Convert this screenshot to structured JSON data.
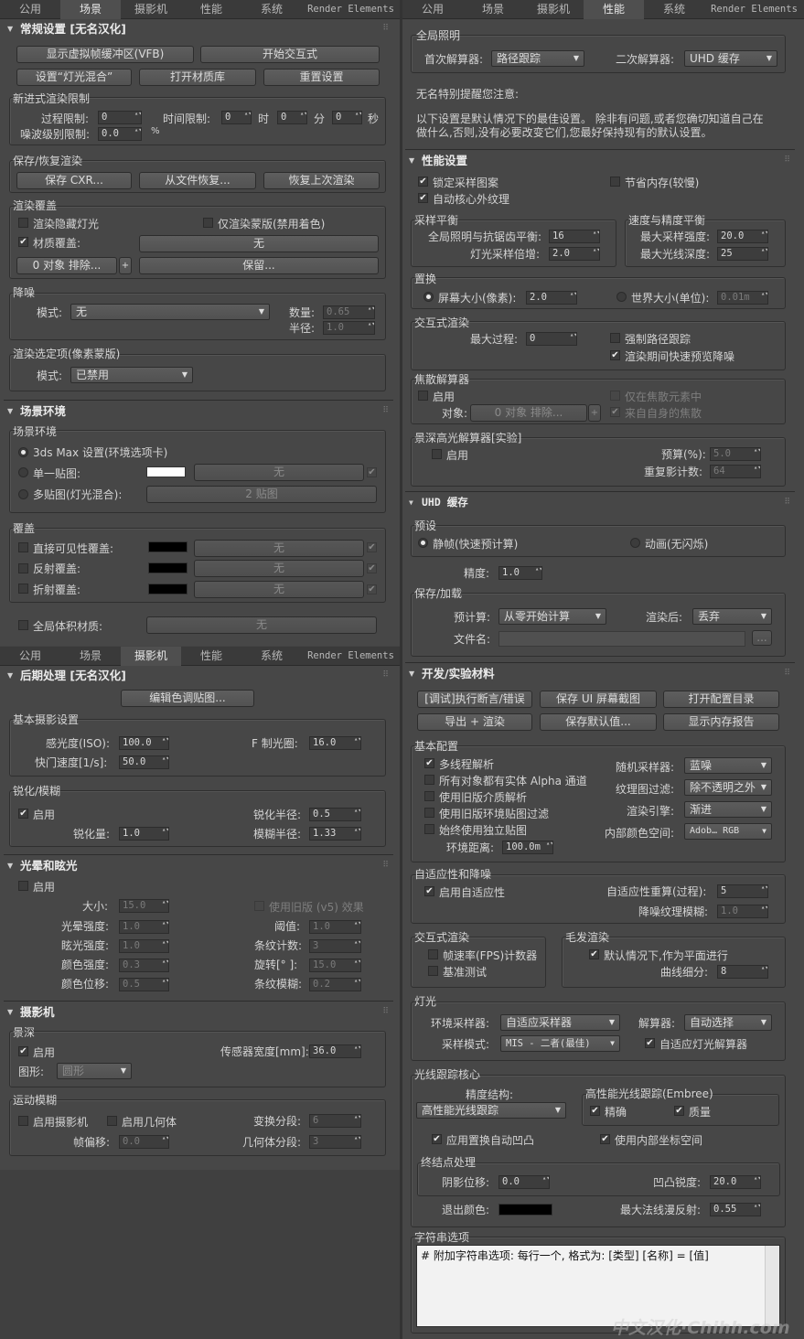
{
  "tabs": {
    "public": "公用",
    "scene": "场景",
    "camera": "摄影机",
    "perf": "性能",
    "system": "系统",
    "render_elements": "Render Elements"
  },
  "general": {
    "title": "常规设置 [无名汉化]",
    "btn_vfb": "显示虚拟帧缓冲区(VFB)",
    "btn_ipr": "开始交互式",
    "btn_lightmix": "设置“灯光混合”",
    "btn_matlib": "打开材质库",
    "btn_reset": "重置设置",
    "limits_title": "新进式渲染限制",
    "passes_label": "过程限制:",
    "passes_val": "0",
    "time_label": "时间限制:",
    "time_h": "0",
    "unit_h": "时",
    "time_m": "0",
    "unit_m": "分",
    "time_s": "0",
    "unit_s": "秒",
    "noise_label": "噪波级别限制:",
    "noise_val": "0.0",
    "noise_unit": "%",
    "save_title": "保存/恢复渲染",
    "btn_save_cxr": "保存 CXR...",
    "btn_restore_file": "从文件恢复...",
    "btn_restore_last": "恢复上次渲染",
    "override_title": "渲染覆盖",
    "render_hidden": "渲染隐藏灯光",
    "mask_only": "仅渲染蒙版(禁用着色)",
    "mtl_override": "材质覆盖:",
    "mtl_none": "无",
    "exclude_btn": "0 对象 排除...",
    "plus": "+",
    "preserve": "保留...",
    "denoise_title": "降噪",
    "mode_label": "模式:",
    "mode_val": "无",
    "amount_label": "数量:",
    "amount_val": "0.65",
    "radius_label": "半径:",
    "radius_val": "1.0",
    "select_title": "渲染选定项(像素蒙版)",
    "sel_mode_label": "模式:",
    "sel_mode_val": "已禁用"
  },
  "environment": {
    "title": "场景环境",
    "group": "场景环境",
    "opt_3ds": "3ds Max 设置(环境选项卡)",
    "opt_single": "单一贴图:",
    "none1": "无",
    "opt_multi": "多贴图(灯光混合):",
    "multi_btn": "2 贴图",
    "override_title": "覆盖",
    "direct_vis": "直接可见性覆盖:",
    "reflect": "反射覆盖:",
    "refract": "折射覆盖:",
    "none": "无",
    "global_vol": "全局体积材质:"
  },
  "postprocess": {
    "title": "后期处理 [无名汉化]",
    "btn_edit_lut": "编辑色调贴图...",
    "basic_title": "基本摄影设置",
    "iso_label": "感光度(ISO):",
    "iso_val": "100.0",
    "fstop_label": "F 制光圈:",
    "fstop_val": "16.0",
    "shutter_label": "快门速度[1/s]:",
    "shutter_val": "50.0",
    "sharp_title": "锐化/模糊",
    "enable": "启用",
    "sharp_radius_label": "锐化半径:",
    "sharp_radius_val": "0.5",
    "sharp_amount_label": "锐化量:",
    "sharp_amount_val": "1.0",
    "blur_radius_label": "模糊半径:",
    "blur_radius_val": "1.33"
  },
  "bloom": {
    "title": "光晕和眩光",
    "enable": "启用",
    "size_label": "大小:",
    "size_val": "15.0",
    "legacy": "使用旧版 (v5) 效果",
    "bloom_int_label": "光晕强度:",
    "bloom_int_val": "1.0",
    "threshold_label": "阈值:",
    "threshold_val": "1.0",
    "glare_int_label": "眩光强度:",
    "glare_int_val": "1.0",
    "streaks_label": "条纹计数:",
    "streaks_val": "3",
    "color_int_label": "颜色强度:",
    "color_int_val": "0.3",
    "rotation_label": "旋转[° ]:",
    "rotation_val": "15.0",
    "color_shift_label": "颜色位移:",
    "color_shift_val": "0.5",
    "streak_blur_label": "条纹模糊:",
    "streak_blur_val": "0.2"
  },
  "camera": {
    "title": "摄影机",
    "dof_title": "景深",
    "enable": "启用",
    "sensor_label": "传感器宽度[mm]:",
    "sensor_val": "36.0",
    "shape_label": "图形:",
    "shape_val": "圆形",
    "mb_title": "运动模糊",
    "enable_cam": "启用摄影机",
    "enable_geo": "启用几何体",
    "transform_label": "变换分段:",
    "transform_val": "6",
    "frame_offset_label": "帧偏移:",
    "frame_offset_val": "0.0",
    "geo_seg_label": "几何体分段:",
    "geo_seg_val": "3"
  },
  "gi": {
    "group": "全局照明",
    "primary_label": "首次解算器:",
    "primary_val": "路径跟踪",
    "secondary_label": "二次解算器:",
    "secondary_val": "UHD 缓存",
    "note1": "无名特别提醒您注意:",
    "note2": "以下设置是默认情况下的最佳设置。 除非有问题,或者您确切知道自己在",
    "note3": "做什么,否则,没有必要改变它们,您最好保持现有的默认设置。"
  },
  "performance": {
    "title": "性能设置",
    "lock_pattern": "锁定采样图案",
    "save_mem": "节省内存(较慢)",
    "auto_ooc": "自动核心外纹理",
    "balance_title": "采样平衡",
    "gi_aa_label": "全局照明与抗锯齿平衡:",
    "gi_aa_val": "16",
    "light_mult_label": "灯光采样倍增:",
    "light_mult_val": "2.0",
    "speed_title": "速度与精度平衡",
    "max_int_label": "最大采样强度:",
    "max_int_val": "20.0",
    "max_depth_label": "最大光线深度:",
    "max_depth_val": "25",
    "disp_title": "置换",
    "screen_size": "屏幕大小(像素):",
    "screen_val": "2.0",
    "world_size": "世界大小(单位):",
    "world_val": "0.01m",
    "ipr_title": "交互式渲染",
    "max_passes_label": "最大过程:",
    "max_passes_val": "0",
    "force_pt": "强制路径跟踪",
    "fast_denoise": "渲染期间快速预览降噪",
    "caustic_title": "焦散解算器",
    "enable": "启用",
    "objects_label": "对象:",
    "objects_btn": "0 对象 排除...",
    "plus": "+",
    "only_caustic": "仅在焦散元素中",
    "from_self": "来自自身的焦散",
    "bokeh_title": "景深高光解算器[实验]",
    "bokeh_enable": "启用",
    "budget_label": "预算(%):",
    "budget_val": "5.0",
    "resample_label": "重复影计数:",
    "resample_val": "64"
  },
  "uhd": {
    "title": "UHD 缓存",
    "preset_title": "预设",
    "still": "静帧(快速预计算)",
    "anim": "动画(无闪烁)",
    "precision_label": "精度:",
    "precision_val": "1.0",
    "saveload_title": "保存/加载",
    "precalc_label": "预计算:",
    "precalc_val": "从零开始计算",
    "after_label": "渲染后:",
    "after_val": "丢弃",
    "filename_label": "文件名:",
    "browse": "..."
  },
  "dev": {
    "title": "开发/实验材料",
    "btn_debug": "[调试]执行断言/错误",
    "btn_save_ui": "保存 UI 屏幕截图",
    "btn_open_cfg": "打开配置目录",
    "btn_export": "导出 + 渲染",
    "btn_save_default": "保存默认值...",
    "btn_mem": "显示内存报告",
    "basic_title": "基本配置",
    "multi_thread": "多线程解析",
    "all_alpha": "所有对象都有实体 Alpha 通道",
    "legacy_medium": "使用旧版介质解析",
    "legacy_env": "使用旧版环境贴图过滤",
    "standalone_map": "始终使用独立贴图",
    "env_dist_label": "环境距离:",
    "env_dist_val": "100.0m",
    "rand_label": "随机采样器:",
    "rand_val": "蓝噪",
    "tex_filter_label": "纹理图过滤:",
    "tex_filter_val": "除不透明之外",
    "engine_label": "渲染引擎:",
    "engine_val": "渐进",
    "color_space_label": "内部颜色空间:",
    "color_space_val": "Adob… RGB",
    "adapt_title": "自适应性和降噪",
    "enable_adapt": "启用自适应性",
    "adapt_reset_label": "自适应性重算(过程):",
    "adapt_reset_val": "5",
    "noise_blur_label": "降噪纹理模糊:",
    "noise_blur_val": "1.0",
    "ipr_title": "交互式渲染",
    "fps": "帧速率(FPS)计数器",
    "benchmark": "基准测试",
    "hair_title": "毛发渲染",
    "hair_flat": "默认情况下,作为平面进行",
    "curve_sub_label": "曲线细分:",
    "curve_sub_val": "8",
    "light_title": "灯光",
    "env_sampler_label": "环境采样器:",
    "env_sampler_val": "自适应采样器",
    "solver_label": "解算器:",
    "solver_val": "自动选择",
    "sample_mode_label": "采样模式:",
    "sample_mode_val": "MIS - 二者(最佳)",
    "adaptive_light": "自适应灯光解算器",
    "rt_title": "光线跟踪核心",
    "accel_label": "精度结构:",
    "accel_val": "高性能光线跟踪",
    "embree_title": "高性能光线跟踪(Embree)",
    "precise": "精确",
    "quality": "质量",
    "auto_bump": "应用置换自动凹凸",
    "internal_coords": "使用内部坐标空间",
    "term_title": "终结点处理",
    "shadow_offset_label": "阴影位移:",
    "shadow_offset_val": "0.0",
    "bump_sharp_label": "凹凸锐度:",
    "bump_sharp_val": "20.0",
    "exit_color_label": "退出颜色:",
    "max_diffuse_label": "最大法线漫反射:",
    "max_diffuse_val": "0.55",
    "str_title": "字符串选项",
    "str_text": "# 附加字符串选项: 每行一个, 格式为: [类型] [名称] = [值]"
  },
  "watermark": "中文汉化·Chihh.com"
}
